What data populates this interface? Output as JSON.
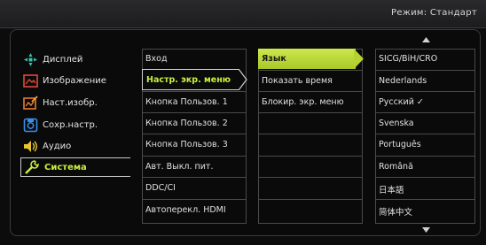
{
  "header": {
    "mode": "Режим: Стандарт"
  },
  "sidebar": {
    "items": [
      {
        "label": "Дисплей",
        "icon": "display-icon"
      },
      {
        "label": "Изображение",
        "icon": "picture-icon"
      },
      {
        "label": "Наст.изобр.",
        "icon": "picture-advanced-icon"
      },
      {
        "label": "Сохр.настр.",
        "icon": "save-settings-icon"
      },
      {
        "label": "Аудио",
        "icon": "speaker-icon"
      },
      {
        "label": "Система",
        "icon": "wrench-icon",
        "active": true
      }
    ]
  },
  "col2": {
    "items": [
      "Вход",
      "Настр. экр. меню",
      "Кнопка Пользов. 1",
      "Кнопка Пользов. 2",
      "Кнопка Пользов. 3",
      "Авт. Выкл. пит.",
      "DDC/CI",
      "Автопеpекл. HDMI"
    ]
  },
  "col3": {
    "items": [
      "Язык",
      "Показать время",
      "Блокир. экр. меню"
    ]
  },
  "col4": {
    "items": [
      "SICG/BiH/CRO",
      "Nederlands",
      "Русский ✓",
      "Svenska",
      "Português",
      "Română",
      "日本語",
      "简体中文"
    ]
  },
  "colors": {
    "accent": "#c8f03c",
    "highlight": "#d0d0d0"
  }
}
